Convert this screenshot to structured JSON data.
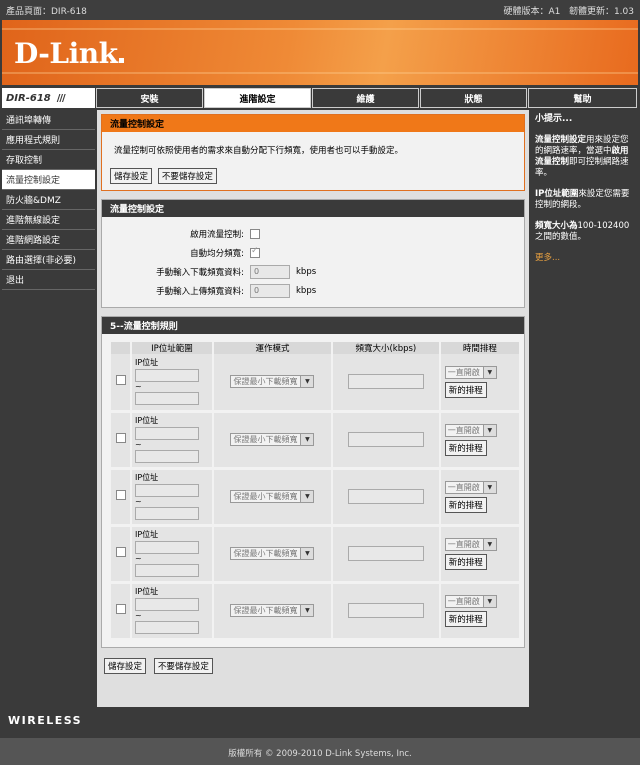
{
  "topbar": {
    "product": "產品頁面：DIR-618",
    "hw_version": "硬體版本：A1",
    "fw_version": "韌體更新：1.03"
  },
  "brand": {
    "logo": "D-Link"
  },
  "nav": {
    "model": "DIR-618",
    "tabs": [
      "安裝",
      "進階設定",
      "維護",
      "狀態",
      "幫助"
    ],
    "active": "進階設定"
  },
  "sidebar": {
    "items": [
      "通訊埠轉傳",
      "應用程式規則",
      "存取控制",
      "流量控制設定",
      "防火牆&DMZ",
      "進階無線設定",
      "進階網路設定",
      "路由選擇(非必要)",
      "退出"
    ],
    "active": "流量控制設定"
  },
  "intro": {
    "title": "流量控制設定",
    "description": "流量控制可依照使用者的需求來自動分配下行頻寬，使用者也可以手動設定。",
    "save_label": "儲存設定",
    "nosave_label": "不要儲存設定"
  },
  "settings": {
    "title": "流量控制設定",
    "enable_label": "啟用流量控制:",
    "enable_checked": false,
    "auto_label": "自動均分頻寬:",
    "auto_checked": true,
    "download_label": "手動輸入下載頻寬資料:",
    "download_value": "0",
    "upload_label": "手動輸入上傳頻寬資料:",
    "upload_value": "0",
    "unit": "kbps"
  },
  "rules": {
    "title": "5--流量控制規則",
    "headers": {
      "ip": "IP位址範圍",
      "mode": "運作模式",
      "bw": "頻寬大小(kbps)",
      "schedule": "時間排程"
    },
    "ip_label": "IP位址",
    "tilde": "~",
    "mode_value": "保證最小下載頻寬",
    "schedule_value": "一直開啟",
    "new_schedule_label": "新的排程",
    "rows": [
      1,
      2,
      3,
      4,
      5
    ]
  },
  "bottom_buttons": {
    "save_label": "儲存設定",
    "nosave_label": "不要儲存設定"
  },
  "tips": {
    "title": "小提示...",
    "p1_bold1": "流量控制設定",
    "p1_text1": "用來設定您的網路速率，當選中",
    "p1_bold2": "啟用流量控制",
    "p1_text2": "即可控制網路速率。",
    "p2_bold": "IP位址範圍",
    "p2_text": "來設定您需要控制的網段。",
    "p3_bold": "頻寬大小為",
    "p3_text": "100-102400之間的數值。",
    "more": "更多..."
  },
  "footer": {
    "wireless": "WIRELESS",
    "copyright": "版權所有 © 2009-2010 D-Link Systems, Inc."
  }
}
